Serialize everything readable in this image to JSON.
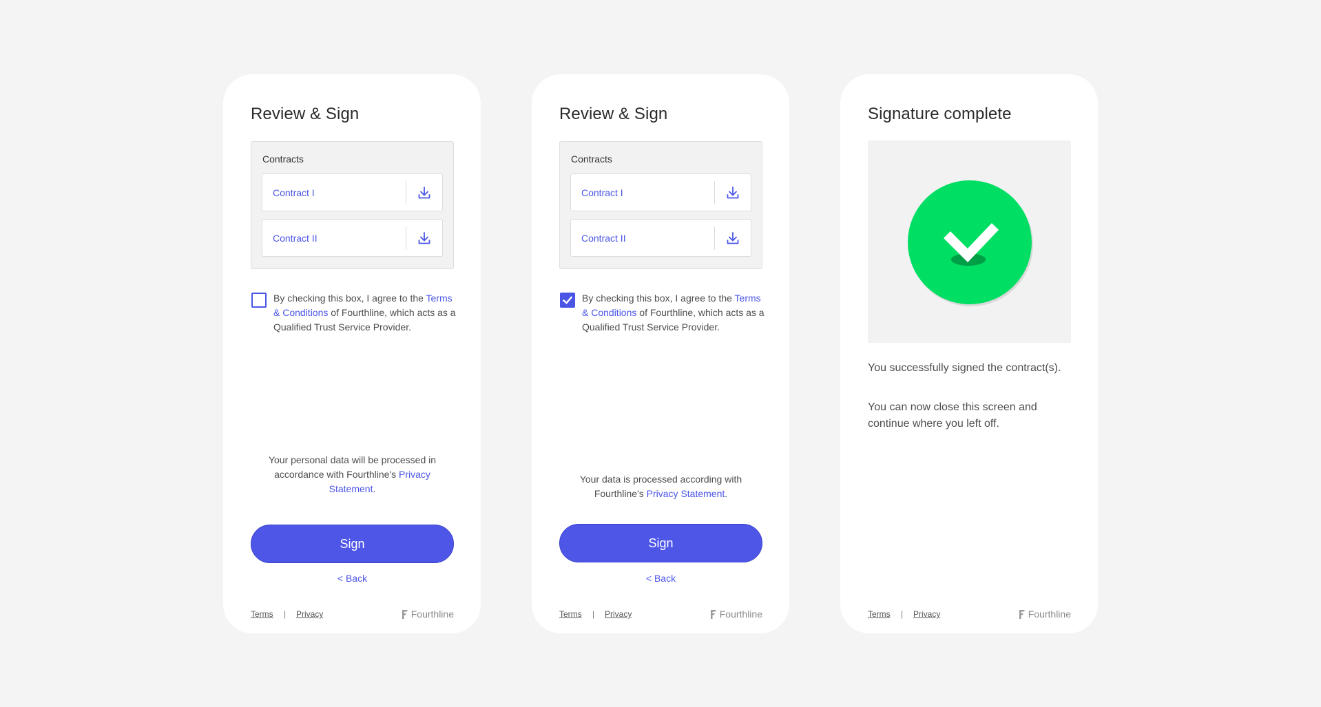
{
  "screens": [
    {
      "title": "Review & Sign",
      "contracts_label": "Contracts",
      "contracts": [
        {
          "name": "Contract I"
        },
        {
          "name": "Contract II"
        }
      ],
      "consent": {
        "checked": false,
        "prefix": "By checking this box, I agree to the ",
        "link": "Terms & Conditions",
        "suffix": " of Fourthline, which acts as a Qualified Trust Service Provider."
      },
      "privacy": {
        "prefix": "Your personal data will be processed in accordance with Fourthline's ",
        "link": "Privacy Statement",
        "suffix": "."
      },
      "sign_label": "Sign",
      "back_label": "< Back"
    },
    {
      "title": "Review & Sign",
      "contracts_label": "Contracts",
      "contracts": [
        {
          "name": "Contract I"
        },
        {
          "name": "Contract II"
        }
      ],
      "consent": {
        "checked": true,
        "prefix": "By checking this box, I agree to the ",
        "link": "Terms & Conditions",
        "suffix": " of Fourthline, which acts as a Qualified Trust Service Provider."
      },
      "privacy": {
        "prefix": "Your data is processed according with Fourthline's ",
        "link": "Privacy Statement",
        "suffix": "."
      },
      "sign_label": "Sign",
      "back_label": "< Back"
    },
    {
      "title": "Signature complete",
      "message_1": "You successfully signed the contract(s).",
      "message_2": "You can now close this screen and continue where you left off."
    }
  ],
  "footer": {
    "terms": "Terms",
    "separator": "|",
    "privacy": "Privacy",
    "brand": "Fourthline"
  },
  "colors": {
    "accent": "#4e56e8",
    "success": "#00de63",
    "background": "#f4f4f4"
  },
  "icons": [
    "download-icon",
    "checkmark-icon",
    "success-check-icon",
    "fourthline-logo-icon"
  ]
}
